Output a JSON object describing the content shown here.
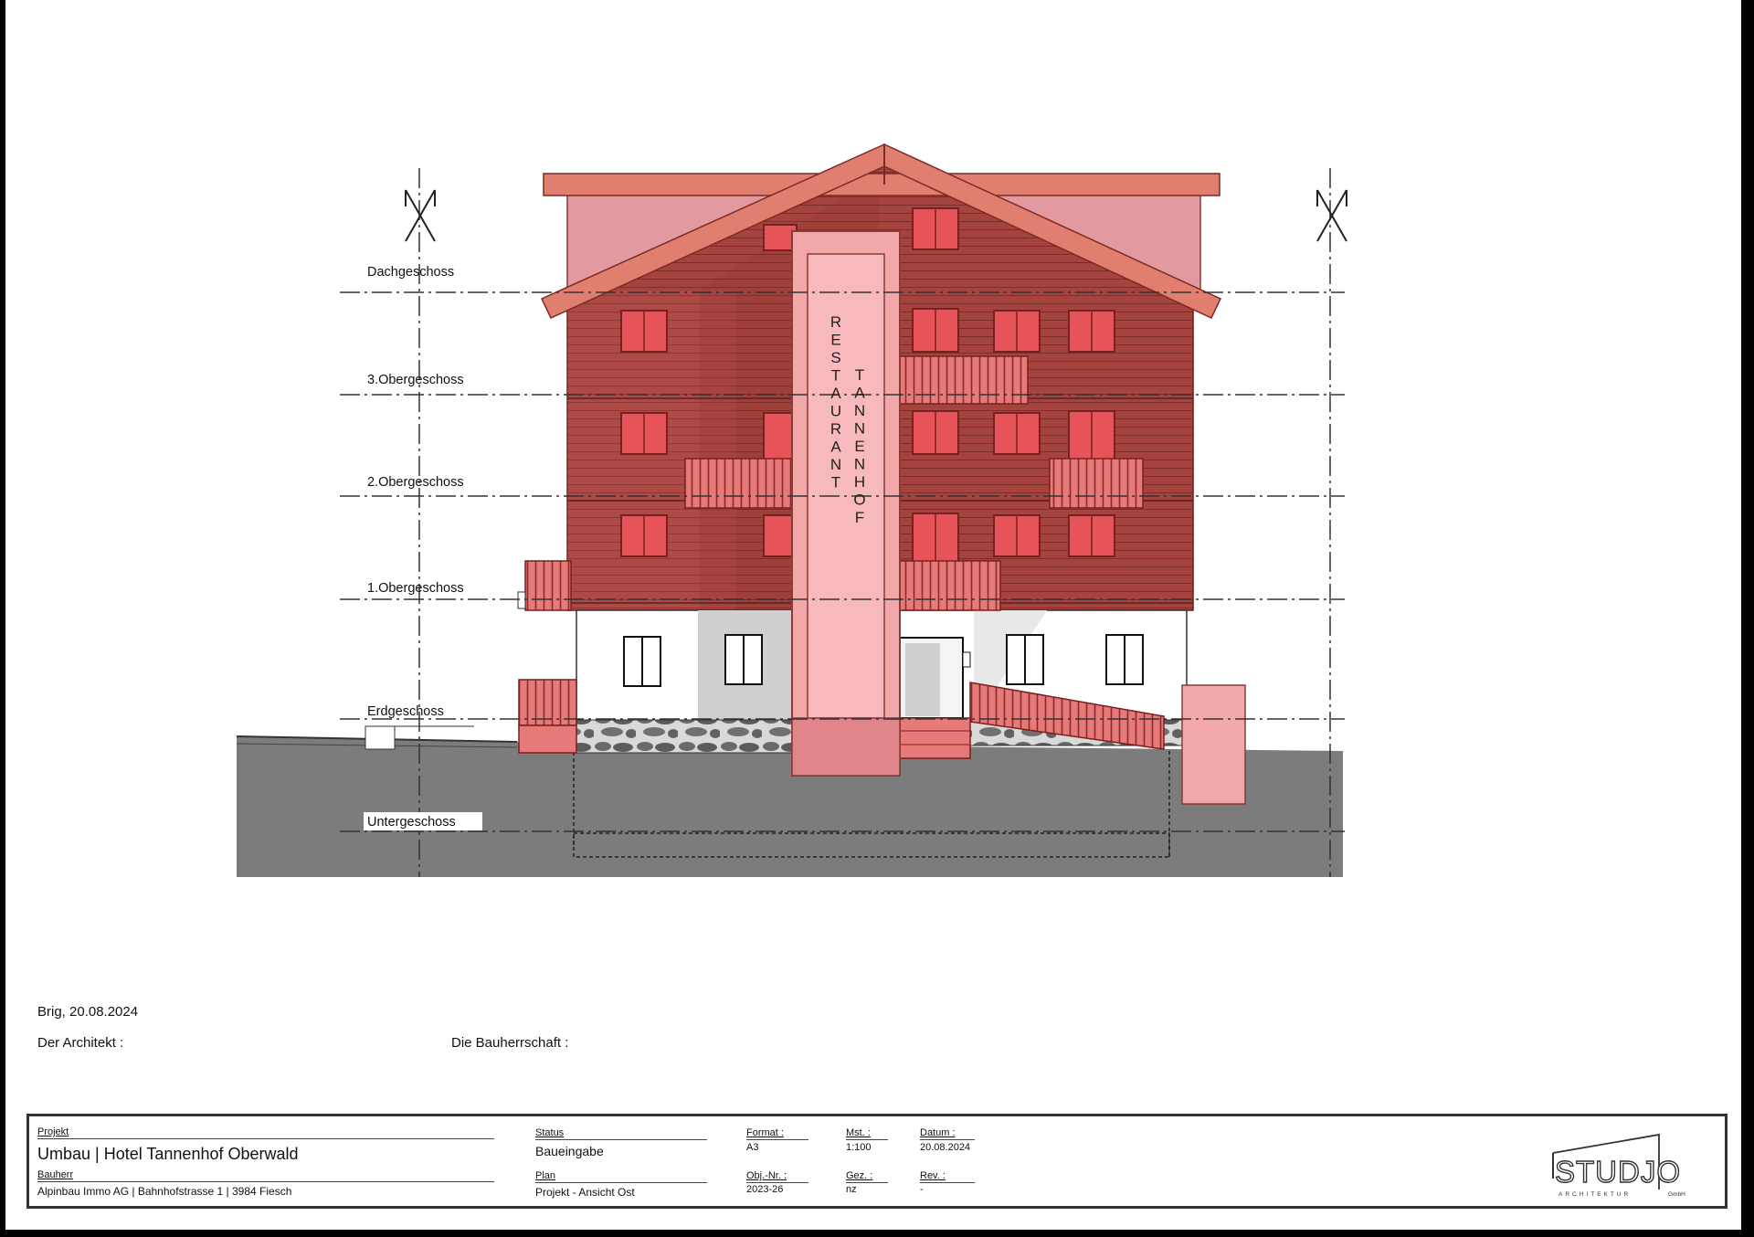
{
  "drawing": {
    "levels": [
      "Dachgeschoss",
      "3.Obergeschoss",
      "2.Obergeschoss",
      "1.Obergeschoss",
      "Erdgeschoss",
      "Untergeschoss"
    ],
    "sign_left": "RESTAURANT",
    "sign_right": "TANNENHOF"
  },
  "signature": {
    "place_date": "Brig, 20.08.2024",
    "architect_label": "Der Architekt :",
    "client_label": "Die Bauherrschaft :"
  },
  "titleblock": {
    "projekt_label": "Projekt",
    "projekt_value": "Umbau | Hotel Tannenhof Oberwald",
    "bauherr_label": "Bauherr",
    "bauherr_value": "Alpinbau Immo AG | Bahnhofstrasse 1 | 3984 Fiesch",
    "status_label": "Status",
    "status_value": "Baueingabe",
    "plan_label": "Plan",
    "plan_value": "Projekt - Ansicht Ost",
    "format_label": "Format :",
    "format_value": "A3",
    "objnr_label": "Obj.-Nr. :",
    "objnr_value": "2023-26",
    "mst_label": "Mst. :",
    "mst_value": "1:100",
    "gez_label": "Gez. :",
    "gez_value": "nz",
    "datum_label": "Datum :",
    "datum_value": "20.08.2024",
    "rev_label": "Rev. :",
    "rev_value": "-",
    "logo_main": "STUDJO",
    "logo_sub": "ARCHITEKTUR",
    "logo_gmbh": "GmbH"
  },
  "colors": {
    "facade": "#a5443f",
    "roof": "#e07f70",
    "pink_overlay": "#f2a7a9",
    "ground": "#7c7c7c",
    "stone": "#6d6d6d"
  }
}
